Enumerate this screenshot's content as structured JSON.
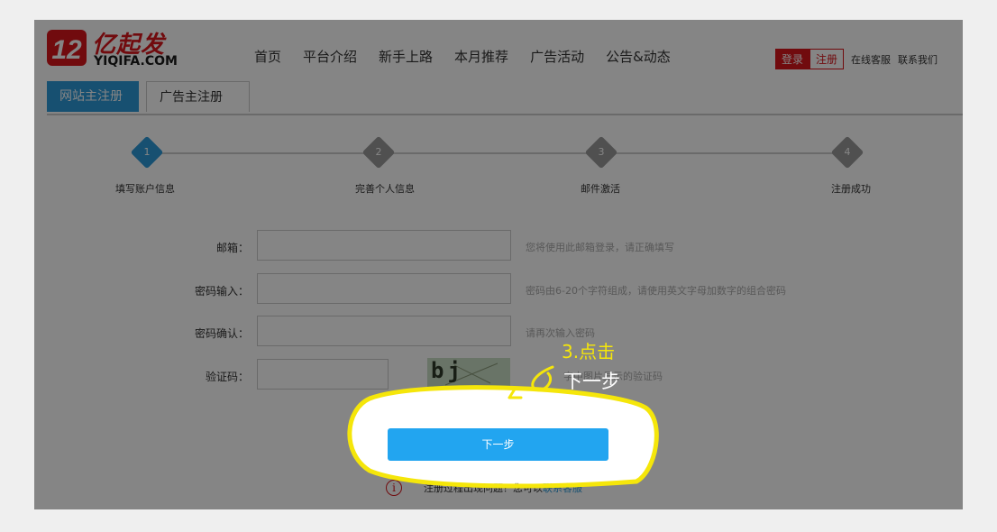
{
  "logo": {
    "cn": "亿起发",
    "en": "YIQIFA.COM"
  },
  "nav": [
    "首页",
    "平台介绍",
    "新手上路",
    "本月推荐",
    "广告活动",
    "公告&动态"
  ],
  "top_right": {
    "login": "登录",
    "register": "注册",
    "links": [
      "在线客服",
      "联系我们"
    ]
  },
  "tabs": [
    "网站主注册",
    "广告主注册"
  ],
  "steps": [
    {
      "num": "1",
      "label": "填写账户信息",
      "active": true
    },
    {
      "num": "2",
      "label": "完善个人信息",
      "active": false
    },
    {
      "num": "3",
      "label": "邮件激活",
      "active": false
    },
    {
      "num": "4",
      "label": "注册成功",
      "active": false
    }
  ],
  "form": {
    "email": {
      "label": "邮箱：",
      "hint": "您将使用此邮箱登录，请正确填写"
    },
    "password": {
      "label": "密码输入：",
      "hint": "密码由6-20个字符组成，请使用英文字母加数字的组合密码"
    },
    "confirm": {
      "label": "密码确认：",
      "hint": "请再次输入密码"
    },
    "captcha": {
      "label": "验证码：",
      "image_text": "bj b8",
      "hint": "字中图片显示的验证码"
    }
  },
  "next_button": "下一步",
  "help": {
    "text": "注册过程出现问题？您可以",
    "link": "联系客服"
  },
  "annotation": {
    "step": "3.点击",
    "action": "下一步"
  },
  "colors": {
    "brand_red": "#d9161c",
    "tab_blue": "#2c9ad8",
    "button_blue": "#22a5f0",
    "annotation_yellow": "#f5e60a"
  }
}
